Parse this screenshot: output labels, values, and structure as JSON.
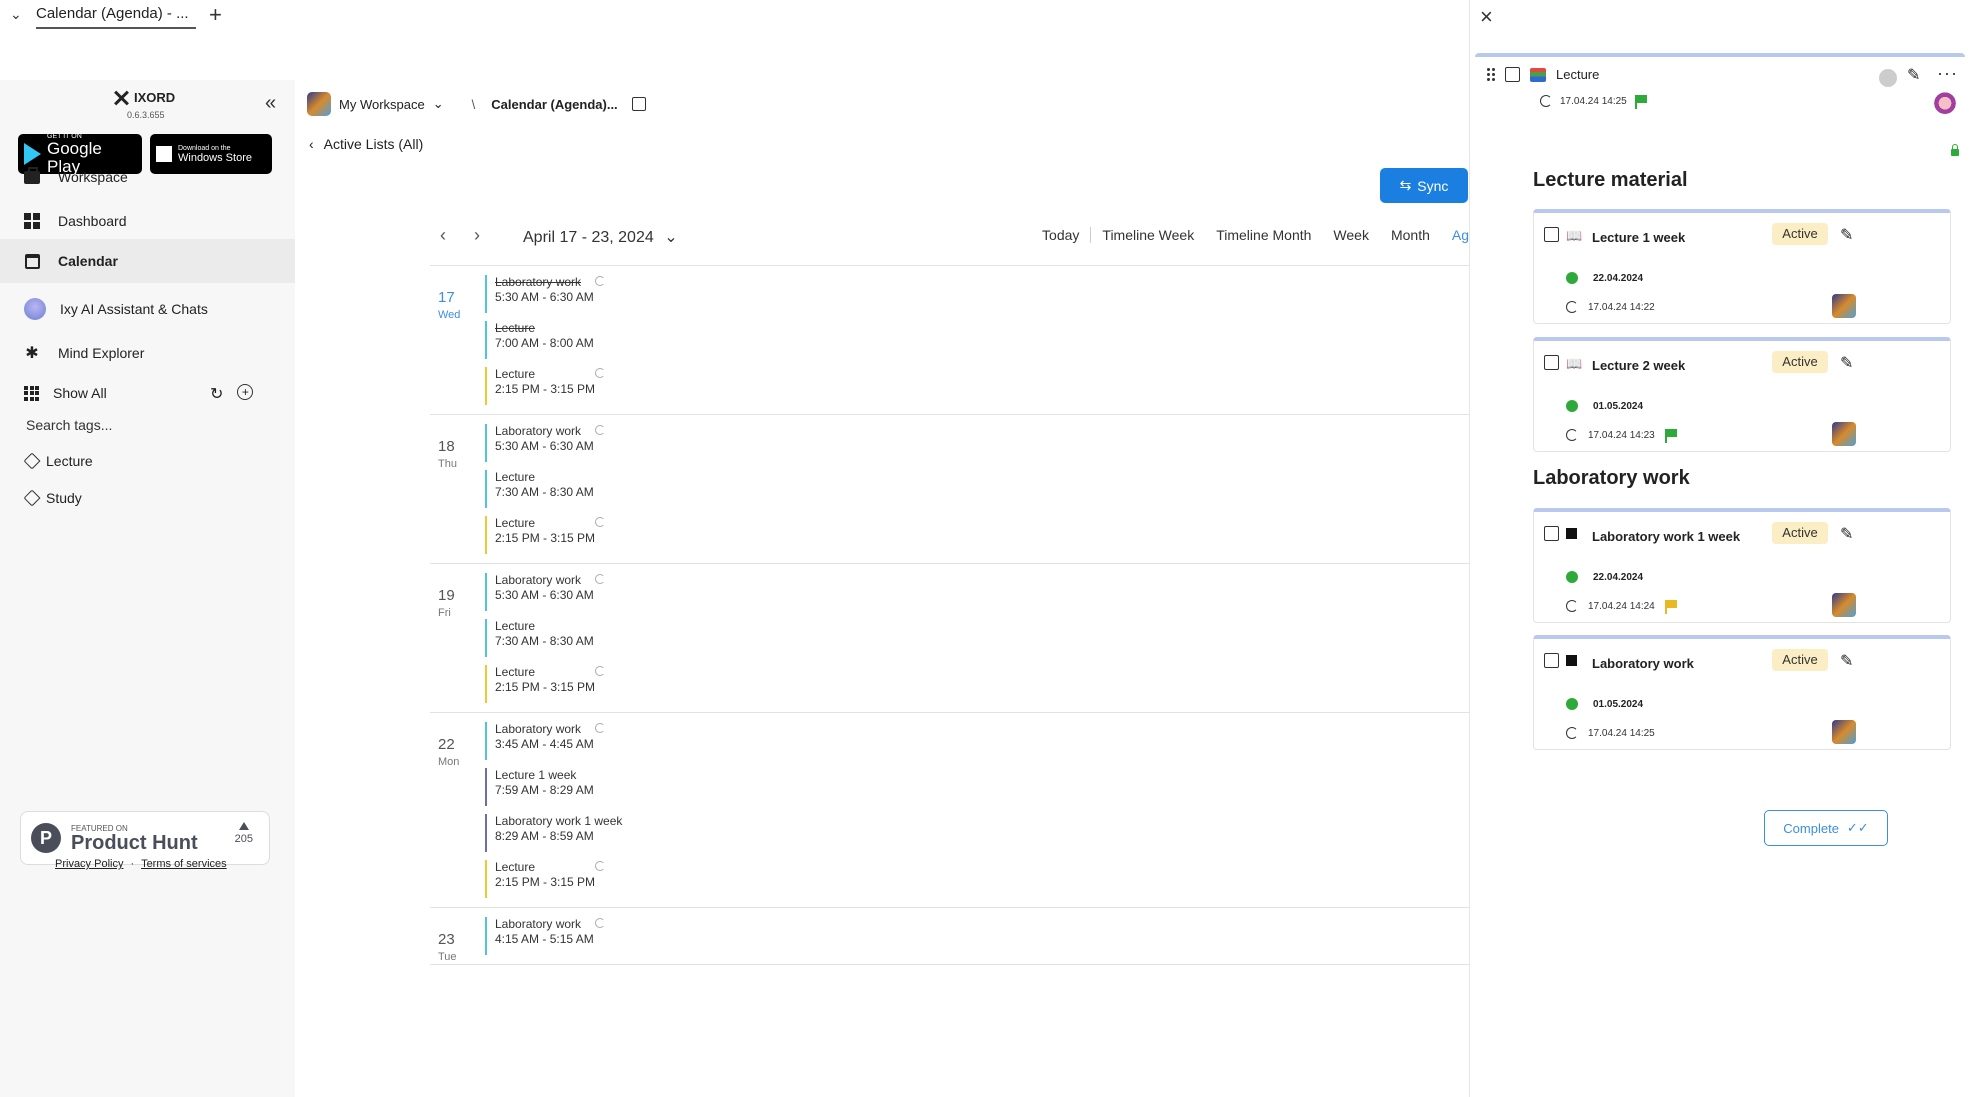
{
  "browser_tab": {
    "title": "Calendar (Agenda) - ...",
    "add_label": "+"
  },
  "sidebar": {
    "brand": "IXORD",
    "version": "0.6.3.655",
    "stores": {
      "google_small": "GET IT ON",
      "google_big": "Google Play",
      "windows_small": "Download on the",
      "windows_big": "Windows Store"
    },
    "nav": [
      {
        "label": "Workspace",
        "icon": "briefcase-icon"
      },
      {
        "label": "Dashboard",
        "icon": "dashboard-icon"
      },
      {
        "label": "Calendar",
        "icon": "calendar-icon",
        "active": true
      },
      {
        "label": "Ixy AI Assistant & Chats",
        "icon": "ai-avatar-icon"
      },
      {
        "label": "Mind Explorer",
        "icon": "mind-map-icon"
      }
    ],
    "show_all": "Show All",
    "search_tags_placeholder": "Search tags...",
    "tags": [
      "Lecture",
      "Study"
    ],
    "product_hunt": {
      "featured": "FEATURED ON",
      "name": "Product Hunt",
      "count": "205"
    },
    "footer": {
      "privacy": "Privacy Policy",
      "sep": "·",
      "terms": "Terms of services"
    }
  },
  "main": {
    "workspace": "My Workspace",
    "breadcrumb_sep": "\\",
    "breadcrumb_title": "Calendar (Agenda)...",
    "back_label": "Active Lists (All)",
    "sync_label": "Sync",
    "range_label": "April 17 - 23, 2024",
    "views": [
      "Today",
      "Timeline Week",
      "Timeline Month",
      "Week",
      "Month",
      "Ag"
    ],
    "days": [
      {
        "num": "17",
        "wk": "Wed",
        "today": true,
        "events": [
          {
            "title": "Laboratory work",
            "time": "5:30 AM - 6:30 AM",
            "strike": true,
            "repeat": true,
            "color": "cyan"
          },
          {
            "title": "Lecture",
            "time": "7:00 AM - 8:00 AM",
            "strike": true,
            "repeat": false,
            "color": "cyan"
          },
          {
            "title": "Lecture",
            "time": "2:15 PM - 3:15 PM",
            "strike": false,
            "repeat": true,
            "color": "yellow"
          }
        ]
      },
      {
        "num": "18",
        "wk": "Thu",
        "events": [
          {
            "title": "Laboratory work",
            "time": "5:30 AM - 6:30 AM",
            "repeat": true,
            "color": "cyan"
          },
          {
            "title": "Lecture",
            "time": "7:30 AM - 8:30 AM",
            "repeat": false,
            "color": "cyan"
          },
          {
            "title": "Lecture",
            "time": "2:15 PM - 3:15 PM",
            "repeat": true,
            "color": "yellow"
          }
        ]
      },
      {
        "num": "19",
        "wk": "Fri",
        "events": [
          {
            "title": "Laboratory work",
            "time": "5:30 AM - 6:30 AM",
            "repeat": true,
            "color": "cyan"
          },
          {
            "title": "Lecture",
            "time": "7:30 AM - 8:30 AM",
            "repeat": false,
            "color": "cyan"
          },
          {
            "title": "Lecture",
            "time": "2:15 PM - 3:15 PM",
            "repeat": true,
            "color": "yellow"
          }
        ]
      },
      {
        "num": "22",
        "wk": "Mon",
        "events": [
          {
            "title": "Laboratory work",
            "time": "3:45 AM - 4:45 AM",
            "repeat": true,
            "color": "cyan"
          },
          {
            "title": "Lecture 1 week",
            "time": "7:59 AM - 8:29 AM",
            "repeat": false,
            "color": "purple"
          },
          {
            "title": "Laboratory work 1 week",
            "time": "8:29 AM - 8:59 AM",
            "repeat": false,
            "color": "purple"
          },
          {
            "title": "Lecture",
            "time": "2:15 PM - 3:15 PM",
            "repeat": true,
            "color": "yellow"
          }
        ]
      },
      {
        "num": "23",
        "wk": "Tue",
        "events": [
          {
            "title": "Laboratory work",
            "time": "4:15 AM - 5:15 AM",
            "repeat": true,
            "color": "cyan"
          }
        ]
      }
    ]
  },
  "panel": {
    "title": "Lecture",
    "date": "17.04.24 14:25",
    "sections": [
      {
        "title": "Lecture material",
        "cards": [
          {
            "title": "Lecture 1 week",
            "icon": "book-icon",
            "status": "Active",
            "due": "22.04.2024",
            "created": "17.04.24 14:22",
            "flag": ""
          },
          {
            "title": "Lecture 2 week",
            "icon": "book-icon",
            "status": "Active",
            "due": "01.05.2024",
            "created": "17.04.24 14:23",
            "flag": "green"
          }
        ]
      },
      {
        "title": "Laboratory work",
        "cards": [
          {
            "title": "Laboratory work 1 week",
            "icon": "square-icon",
            "status": "Active",
            "due": "22.04.2024",
            "created": "17.04.24 14:24",
            "flag": "yellow"
          },
          {
            "title": "Laboratory work",
            "icon": "square-icon",
            "status": "Active",
            "due": "01.05.2024",
            "created": "17.04.24 14:25",
            "flag": ""
          }
        ]
      }
    ],
    "complete_label": "Complete"
  },
  "colors": {
    "accent": "#1a7fe0",
    "today": "#3b8fe0",
    "cyan": "#4fc3e0",
    "yellow": "#f4c633",
    "purple": "#6c6fa5",
    "badge": "#fbedc4",
    "flag_green": "#2eaa3a"
  }
}
